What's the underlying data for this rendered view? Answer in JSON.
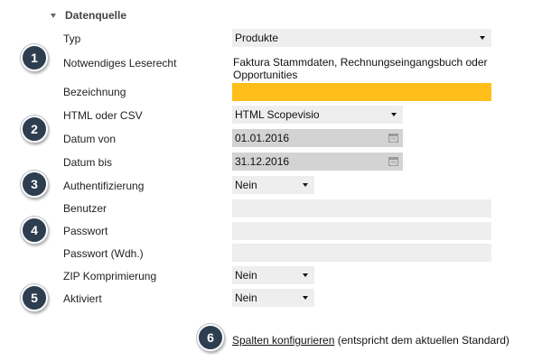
{
  "section": {
    "title": "Datenquelle"
  },
  "fields": {
    "typ": {
      "label": "Typ",
      "value": "Produkte"
    },
    "leserecht": {
      "label": "Notwendiges Leserecht",
      "value": "Faktura Stammdaten, Rechnungseingangsbuch oder Opportunities"
    },
    "bezeichnung": {
      "label": "Bezeichnung",
      "value": ""
    },
    "format": {
      "label": "HTML oder CSV",
      "value": "HTML Scopevisio"
    },
    "datum_von": {
      "label": "Datum von",
      "value": "01.01.2016"
    },
    "datum_bis": {
      "label": "Datum bis",
      "value": "31.12.2016"
    },
    "auth": {
      "label": "Authentifizierung",
      "value": "Nein"
    },
    "benutzer": {
      "label": "Benutzer",
      "value": ""
    },
    "passwort": {
      "label": "Passwort",
      "value": ""
    },
    "passwort_wdh": {
      "label": "Passwort (Wdh.)",
      "value": ""
    },
    "zip": {
      "label": "ZIP Komprimierung",
      "value": "Nein"
    },
    "aktiviert": {
      "label": "Aktiviert",
      "value": "Nein"
    }
  },
  "badges": [
    "1",
    "2",
    "3",
    "4",
    "5",
    "6"
  ],
  "footer": {
    "link_label": "Spalten konfigurieren",
    "note": " (entspricht dem aktuellen Standard)"
  },
  "colors": {
    "highlight": "#ffbe1a",
    "badge": "#2d3e50",
    "field_bg": "#eeeeee",
    "date_bg": "#d3d3d3"
  },
  "icons": {
    "section_toggle": "triangle-down-icon",
    "dropdown": "caret-down-icon",
    "calendar": "calendar-icon"
  }
}
